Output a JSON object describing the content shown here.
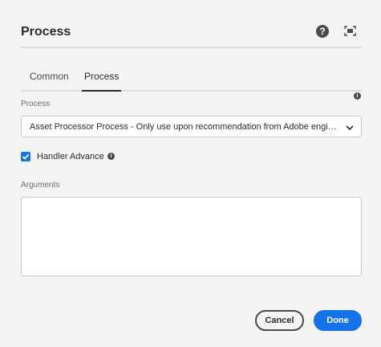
{
  "dialog": {
    "title": "Process",
    "help_glyph": "?",
    "help_icon": "help-circle-icon",
    "fullscreen_icon": "fullscreen-icon"
  },
  "tabs": [
    {
      "label": "Common",
      "selected": false
    },
    {
      "label": "Process",
      "selected": true
    }
  ],
  "process_field": {
    "label": "Process",
    "info_glyph": "i",
    "value": "Asset Processor Process - Only use upon recommendation from Adobe engineering"
  },
  "handler_advance": {
    "label": "Handler Advance",
    "checked": true,
    "info_glyph": "i"
  },
  "arguments_field": {
    "label": "Arguments",
    "value": "",
    "placeholder": ""
  },
  "footer": {
    "cancel_label": "Cancel",
    "done_label": "Done"
  },
  "colors": {
    "accent": "#1473e6",
    "background": "#f4f4f4"
  }
}
